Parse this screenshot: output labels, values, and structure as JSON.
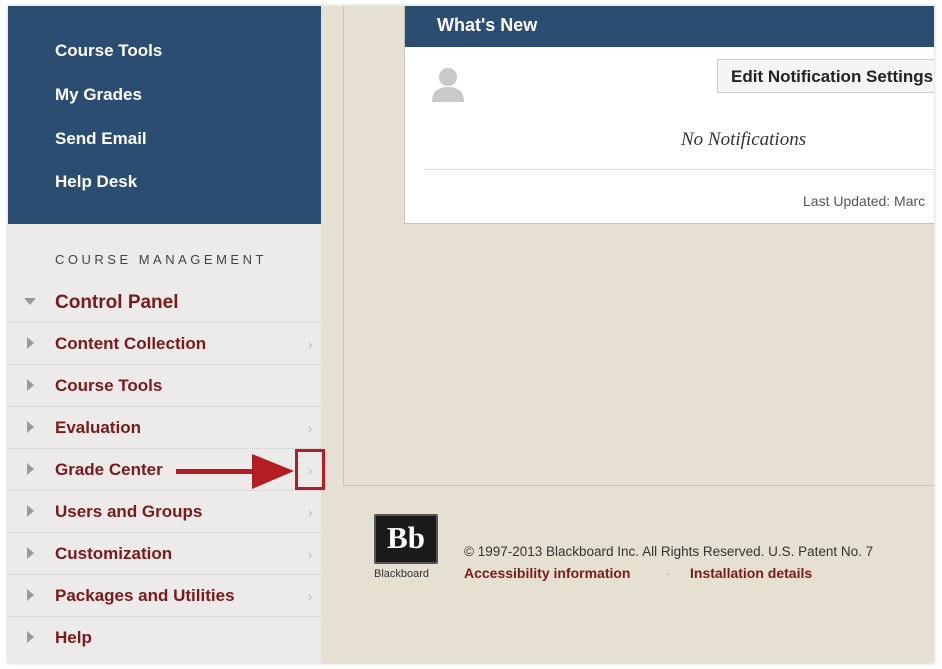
{
  "course_nav": {
    "items": [
      {
        "label": "Course Tools"
      },
      {
        "label": "My Grades"
      },
      {
        "label": "Send Email"
      },
      {
        "label": "Help Desk"
      }
    ]
  },
  "course_management": {
    "heading": "COURSE MANAGEMENT",
    "control_panel": {
      "label": "Control Panel",
      "expanded": true,
      "items": [
        {
          "label": "Content Collection",
          "has_submenu": true
        },
        {
          "label": "Course Tools",
          "has_submenu": false
        },
        {
          "label": "Evaluation",
          "has_submenu": true
        },
        {
          "label": "Grade Center",
          "has_submenu": true,
          "highlighted": true
        },
        {
          "label": "Users and Groups",
          "has_submenu": true
        },
        {
          "label": "Customization",
          "has_submenu": true
        },
        {
          "label": "Packages and Utilities",
          "has_submenu": true
        },
        {
          "label": "Help",
          "has_submenu": false
        }
      ]
    }
  },
  "whats_new": {
    "title": "What's New",
    "edit_button": "Edit Notification Settings",
    "empty_message": "No Notifications",
    "last_updated": "Last Updated: Marc"
  },
  "footer": {
    "logo_text": "Bb",
    "logo_name": "Blackboard",
    "copyright": "© 1997-2013 Blackboard Inc. All Rights Reserved. U.S. Patent No. 7",
    "links": [
      {
        "label": "Accessibility information"
      },
      {
        "label": "Installation details"
      }
    ],
    "separator": "·"
  },
  "colors": {
    "nav_blue": "#2a4d71",
    "link_maroon": "#7a1a1a",
    "highlight_red": "#b21e24",
    "page_beige": "#e6e0d2"
  }
}
